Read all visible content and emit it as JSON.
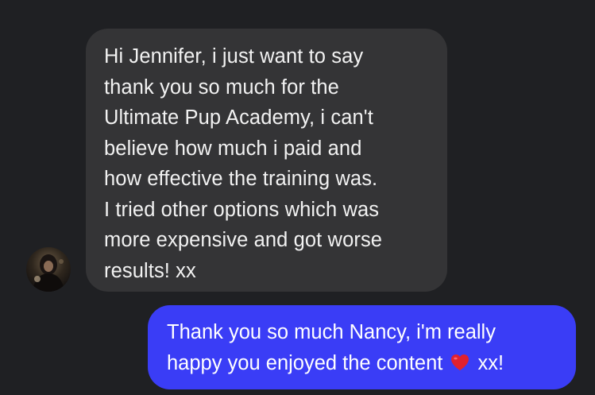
{
  "conversation": {
    "incoming": {
      "lines": [
        "Hi Jennifer, i just want to say",
        "thank you so much for the",
        "Ultimate Pup Academy, i can't",
        "believe how much i paid and",
        "how effective the training was.",
        "I tried other options which was",
        "more expensive and got worse",
        "results! xx"
      ]
    },
    "outgoing": {
      "line1": "Thank you so much Nancy, i'm really",
      "line2_before_emoji": "happy you enjoyed the content",
      "emoji": "red-heart-icon",
      "line2_after_emoji": "xx!"
    }
  },
  "colors": {
    "background": "#1f2023",
    "incoming_bubble": "#343436",
    "outgoing_bubble": "#3a3df6",
    "text": "#f2f2f2",
    "heart": "#e0212f"
  }
}
